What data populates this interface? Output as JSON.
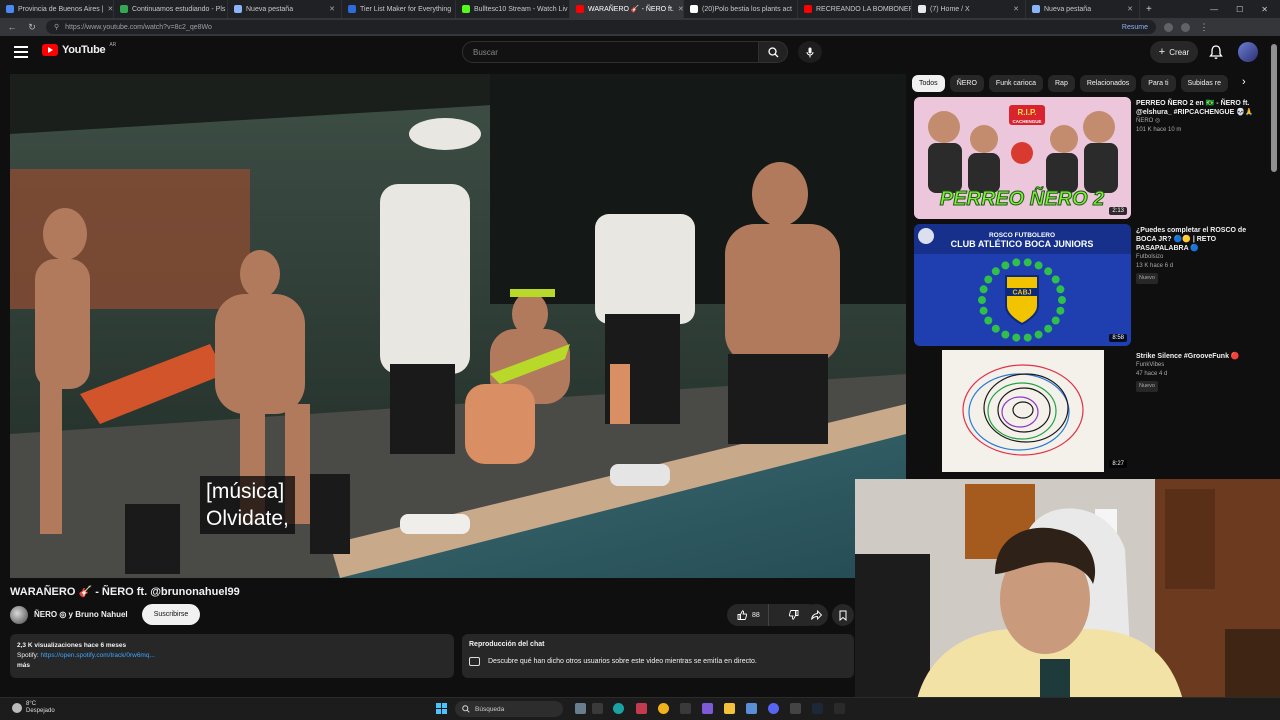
{
  "browser": {
    "tabs": [
      {
        "title": "Provincia de Buenos Aires |",
        "color": "#4a8af4",
        "active": false
      },
      {
        "title": "Continuamos estudiando - Pls",
        "color": "#34a853",
        "active": false
      },
      {
        "title": "Nueva pestaña",
        "color": "#8ab4f8",
        "active": false
      },
      {
        "title": "Tier List Maker for Everything",
        "color": "#2d6cdf",
        "active": false
      },
      {
        "title": "Bulltesc10 Stream - Watch Liv",
        "color": "#53fc18",
        "active": false
      },
      {
        "title": "WARAÑERO 🎸 - ÑERO ft.",
        "color": "#ff0000",
        "active": true
      },
      {
        "title": "(20)Polo bestia los plants act",
        "color": "#ffffff",
        "active": false
      },
      {
        "title": "RECREANDO LA BOMBONERA",
        "color": "#ff0000",
        "active": false
      },
      {
        "title": "(7) Home / X",
        "color": "#e7e9ea",
        "active": false
      },
      {
        "title": "Nueva pestaña",
        "color": "#8ab4f8",
        "active": false
      }
    ],
    "url": "https://www.youtube.com/watch?v=8c2_qe8Wo",
    "resume_label": "Resume"
  },
  "header": {
    "logo_text": "YouTube",
    "logo_country": "AR",
    "search_placeholder": "Buscar",
    "create_label": "Crear"
  },
  "video": {
    "caption_line1": "[música]",
    "caption_line2": "Olvidate,",
    "title": "WARAÑERO 🎸 - ÑERO ft. @brunonahuel99",
    "channel": "ÑERO ◎ y Bruno Nahuel",
    "subscribe_label": "Suscribirse",
    "likes": "88",
    "description": {
      "stats": "2,3 K visualizaciones  hace 6 meses",
      "spotify_label": "Spotify: ",
      "spotify_link": "https://open.spotify.com/track/0rw6mq...",
      "more_label": "más"
    },
    "chat": {
      "title": "Reproducción del chat",
      "text": "Descubre qué han dicho otros usuarios sobre este video mientras se emitía en directo."
    }
  },
  "chips": [
    "Todos",
    "ÑERO",
    "Funk carioca",
    "Rap",
    "Relacionados",
    "Para ti",
    "Subidas re"
  ],
  "recommendations": [
    {
      "title": "PERREO ÑERO 2 en 🇧🇷 - ÑERO ft. @elshura_ #RIPCACHENGUE 💀🙏",
      "channel": "ÑERO ◎",
      "views": "101 K  hace 10 m",
      "duration": "2:13",
      "badge": ""
    },
    {
      "title": "¿Puedes completar el ROSCO de BOCA JR? 🔵🟡 | RETO PASAPALABRA 🔵",
      "channel": "Futbolsizo",
      "views": "13 K  hace 6 d",
      "duration": "8:58",
      "badge": "Nuevo"
    },
    {
      "title": "Strike Silence #GrooveFunk 🔴",
      "channel": "FunkVibes",
      "views": "47  hace 4 d",
      "duration": "8:27",
      "badge": "Nuevo"
    }
  ],
  "thumb_texts": {
    "perreo_top": "R.I.P.",
    "perreo_sub": "CACHENGUE",
    "perreo_main": "PERREO ÑERO 2",
    "boca_top": "ROSCO FUTBOLERO",
    "boca_main": "CLUB ATLÉTICO BOCA JUNIORS",
    "boca_crest": "CABJ"
  },
  "taskbar": {
    "temp": "8°C",
    "weather": "Despejado",
    "search_label": "Búsqueda"
  }
}
